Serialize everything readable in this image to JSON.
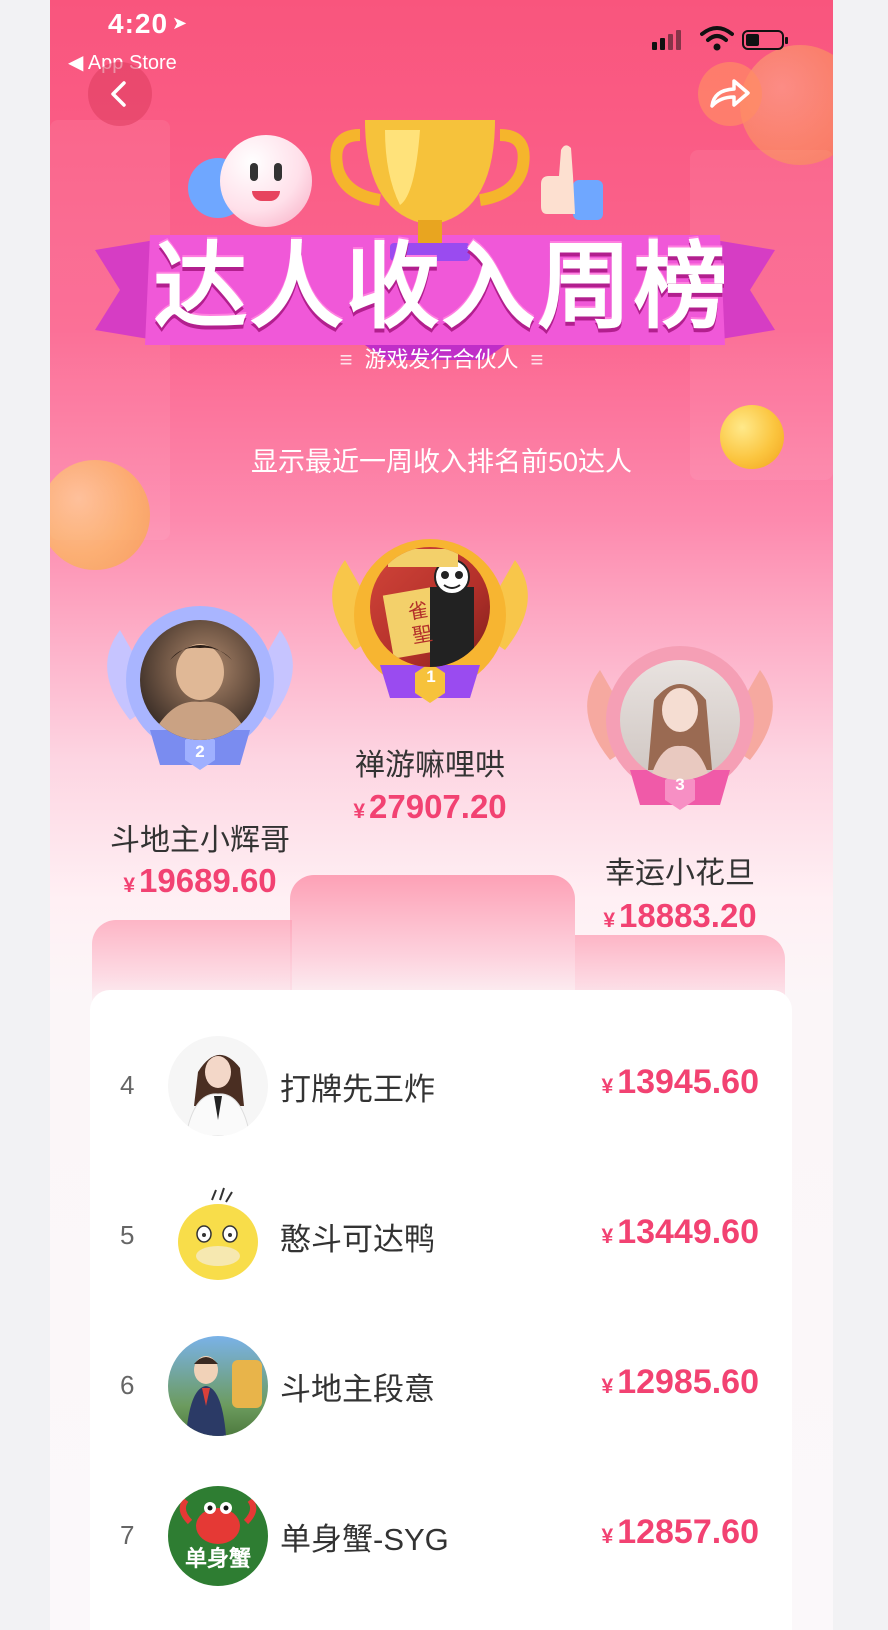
{
  "status_bar": {
    "time": "4:20",
    "back_app": "◀ App Store"
  },
  "header": {
    "title": "达人收入周榜",
    "subtitle": "游戏发行合伙人",
    "hint": "显示最近一周收入排名前50达人"
  },
  "currency": "¥",
  "podium": [
    {
      "rank": "2",
      "name": "斗地主小辉哥",
      "amount": "19689.60"
    },
    {
      "rank": "1",
      "name": "禅游嘛哩哄",
      "amount": "27907.20"
    },
    {
      "rank": "3",
      "name": "幸运小花旦",
      "amount": "18883.20"
    }
  ],
  "list": [
    {
      "rank": "4",
      "name": "打牌先王炸",
      "amount": "13945.60"
    },
    {
      "rank": "5",
      "name": "憨斗可达鸭",
      "amount": "13449.60"
    },
    {
      "rank": "6",
      "name": "斗地主段意",
      "amount": "12985.60"
    },
    {
      "rank": "7",
      "name": "单身蟹-SYG",
      "amount": "12857.60"
    }
  ],
  "avatar_texts": {
    "panel_1": "雀",
    "panel_2": "聖",
    "crab_label": "单身蟹"
  },
  "colors": {
    "accent": "#f24272",
    "header_pink": "#f9557d",
    "rank1_purple": "#9a4bf0",
    "rank2_blue": "#7a8cf0",
    "rank3_pink": "#f05aa8",
    "gold": "#f6c23b"
  }
}
